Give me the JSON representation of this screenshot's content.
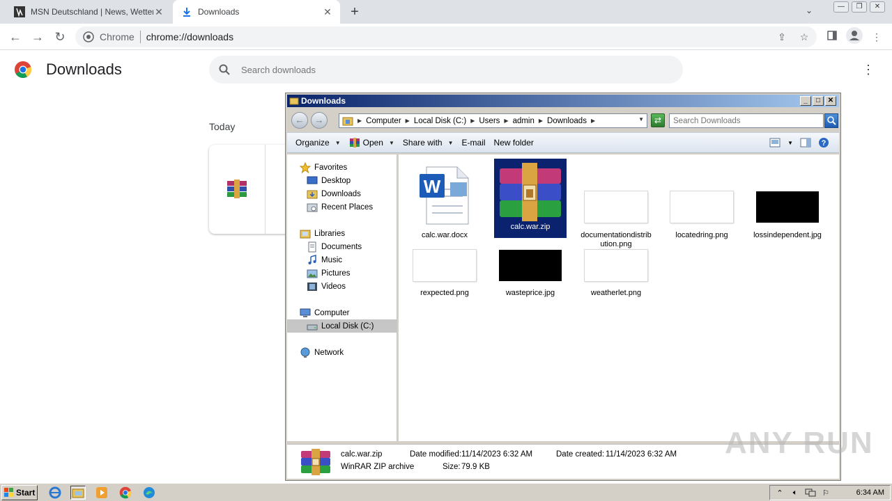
{
  "browser": {
    "tabs": [
      {
        "title": "MSN Deutschland | News, Wetter, Sp",
        "icon": "msn-icon",
        "active": false
      },
      {
        "title": "Downloads",
        "icon": "download-icon",
        "active": true
      }
    ],
    "omnibox": {
      "scheme_label": "Chrome",
      "url": "chrome://downloads"
    }
  },
  "downloads_page": {
    "title": "Downloads",
    "search_placeholder": "Search downloads",
    "section_today": "Today"
  },
  "explorer": {
    "title": "Downloads",
    "breadcrumbs": [
      "Computer",
      "Local Disk (C:)",
      "Users",
      "admin",
      "Downloads"
    ],
    "search_placeholder": "Search Downloads",
    "commands": {
      "organize": "Organize",
      "open": "Open",
      "share_with": "Share with",
      "email": "E-mail",
      "new_folder": "New folder"
    },
    "nav": {
      "favorites": "Favorites",
      "desktop": "Desktop",
      "downloads": "Downloads",
      "recent_places": "Recent Places",
      "libraries": "Libraries",
      "documents": "Documents",
      "music": "Music",
      "pictures": "Pictures",
      "videos": "Videos",
      "computer": "Computer",
      "local_disk": "Local Disk (C:)",
      "network": "Network"
    },
    "files": [
      {
        "name": "calc.war.docx",
        "thumb": "word-icon"
      },
      {
        "name": "calc.war.zip",
        "thumb": "winrar-icon",
        "selected": true
      },
      {
        "name": "documentationdistribution.png",
        "thumb": "blank"
      },
      {
        "name": "locatedring.png",
        "thumb": "blank"
      },
      {
        "name": "lossindependent.jpg",
        "thumb": "black"
      },
      {
        "name": "rexpected.png",
        "thumb": "blank"
      },
      {
        "name": "wasteprice.jpg",
        "thumb": "black"
      },
      {
        "name": "weatherlet.png",
        "thumb": "blank"
      }
    ],
    "details": {
      "name": "calc.war.zip",
      "type": "WinRAR ZIP archive",
      "date_modified_label": "Date modified:",
      "date_modified": "11/14/2023 6:32 AM",
      "date_created_label": "Date created:",
      "date_created": "11/14/2023 6:32 AM",
      "size_label": "Size:",
      "size": "79.9 KB"
    }
  },
  "taskbar": {
    "start_label": "Start",
    "clock": "6:34 AM"
  },
  "watermark": "ANY RUN",
  "colors": {
    "selection": "#0b236e",
    "titlebar_start": "#0a246a",
    "titlebar_end": "#a6caf0",
    "taskbar": "#d4d0c8"
  }
}
